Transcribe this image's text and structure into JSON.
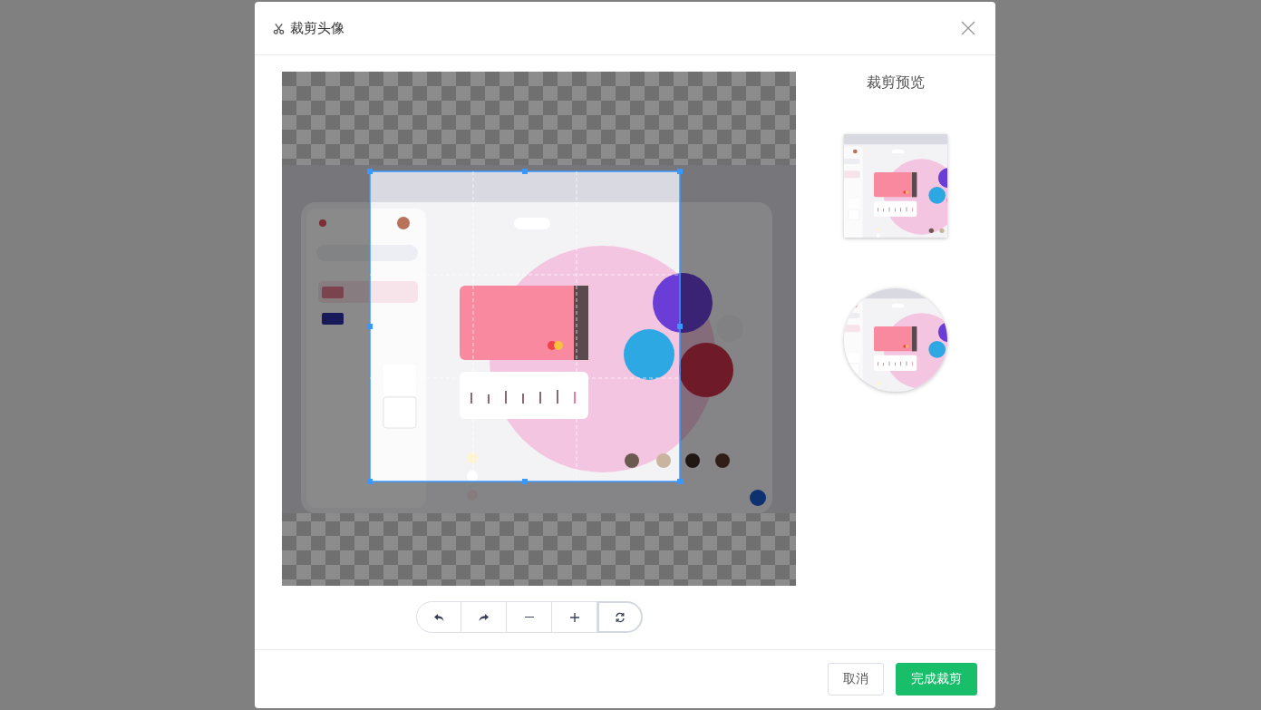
{
  "dialog": {
    "title": "裁剪头像"
  },
  "preview": {
    "title": "裁剪预览",
    "shapes": [
      {
        "kind": "square"
      },
      {
        "kind": "round"
      }
    ]
  },
  "tools": [
    {
      "selected": false
    },
    {
      "selected": false
    },
    {
      "selected": false
    },
    {
      "selected": false
    },
    {
      "selected": true
    }
  ],
  "footer_buttons": [
    {
      "label": "取消",
      "kind": "default"
    },
    {
      "label": "完成裁剪",
      "kind": "primary"
    }
  ]
}
